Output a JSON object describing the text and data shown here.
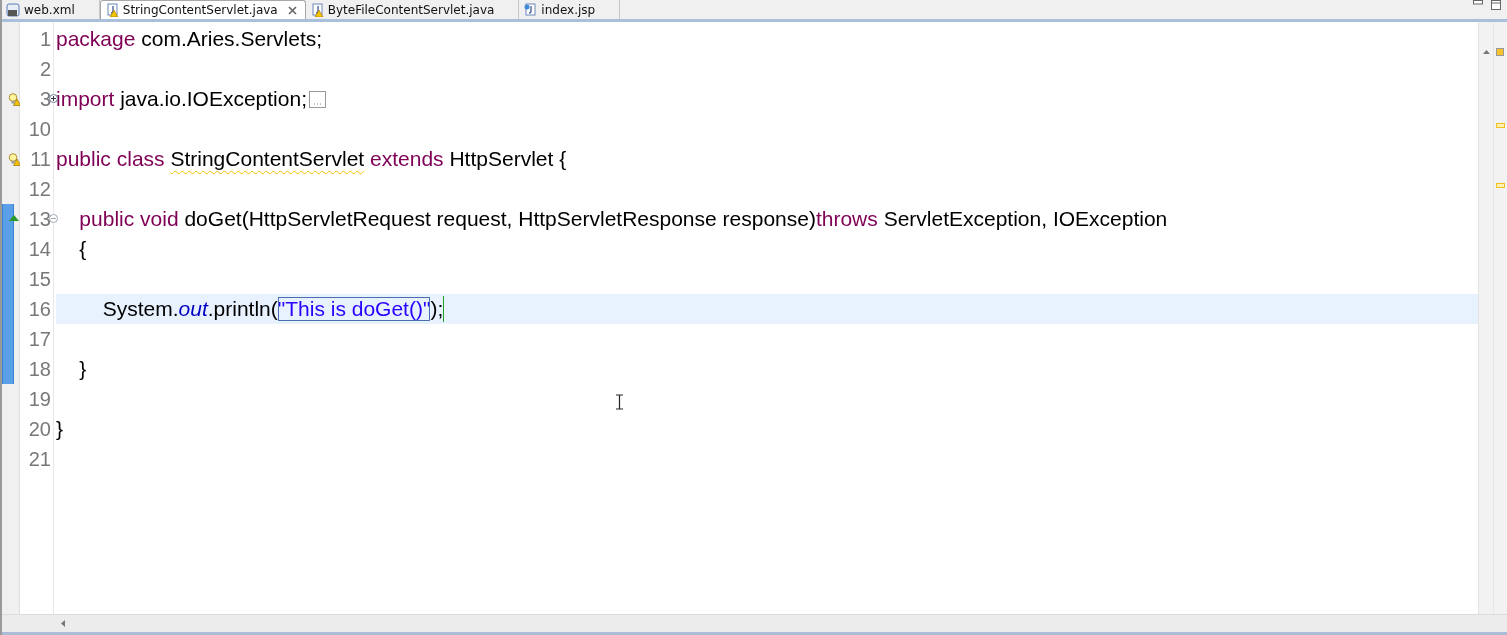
{
  "tabs": [
    {
      "label": "web.xml",
      "kind": "xml",
      "selected": false,
      "closable": false
    },
    {
      "label": "StringContentServlet.java",
      "kind": "java",
      "selected": true,
      "closable": true
    },
    {
      "label": "ByteFileContentServlet.java",
      "kind": "java",
      "selected": false,
      "closable": false
    },
    {
      "label": "index.jsp",
      "kind": "jsp",
      "selected": false,
      "closable": false
    }
  ],
  "editor": {
    "lines": [
      {
        "number": "1",
        "tokens": [
          {
            "kind": "keyword",
            "text": "package"
          },
          {
            "kind": "plain",
            "text": " com.Aries.Servlets;"
          }
        ]
      },
      {
        "number": "2"
      },
      {
        "number": "3",
        "warning": true,
        "collapsed": true,
        "tokens": [
          {
            "kind": "keyword",
            "text": "import"
          },
          {
            "kind": "plain",
            "text": " java.io.IOException;"
          }
        ]
      },
      {
        "number": "10"
      },
      {
        "number": "11",
        "warning": true,
        "tokens": [
          {
            "kind": "keyword",
            "text": "public"
          },
          {
            "kind": "keyword",
            "text": " class"
          },
          {
            "kind": "warning",
            "text": " StringContentServlet"
          },
          {
            "kind": "keyword",
            "text": " extends"
          },
          {
            "kind": "plain",
            "text": " HttpServlet {"
          }
        ]
      },
      {
        "number": "12"
      },
      {
        "number": "13",
        "override": true,
        "collapsed": false,
        "changed": true,
        "tokens": [
          {
            "kind": "keyword",
            "text": "    public"
          },
          {
            "kind": "keyword",
            "text": " void"
          },
          {
            "kind": "plain",
            "text": " doGet(HttpServletRequest request, HttpServletResponse response)"
          },
          {
            "kind": "keyword",
            "text": "throws"
          },
          {
            "kind": "plain",
            "text": " ServletException, IOException"
          }
        ]
      },
      {
        "number": "14",
        "changed": true,
        "tokens": [
          {
            "kind": "plain",
            "text": "    {"
          }
        ]
      },
      {
        "number": "15",
        "changed": true
      },
      {
        "number": "16",
        "changed": true,
        "current": true,
        "tokens": [
          {
            "kind": "plain",
            "text": "        System."
          },
          {
            "kind": "field",
            "text": "out"
          },
          {
            "kind": "plain",
            "text": ".println("
          },
          {
            "kind": "string",
            "text": "\"This is doGet()\"",
            "linked": true
          },
          {
            "kind": "plain",
            "text": ");"
          }
        ]
      },
      {
        "number": "17",
        "changed": true
      },
      {
        "number": "18",
        "changed": true,
        "tokens": [
          {
            "kind": "plain",
            "text": "    }"
          }
        ]
      },
      {
        "number": "19"
      },
      {
        "number": "20",
        "tokens": [
          {
            "kind": "plain",
            "text": "}"
          }
        ]
      },
      {
        "number": "21"
      }
    ]
  }
}
